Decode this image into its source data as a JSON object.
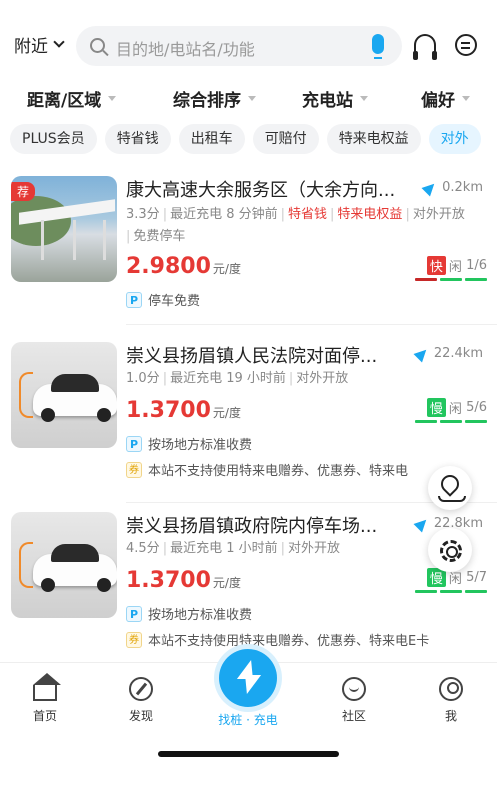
{
  "header": {
    "location": "附近",
    "search_placeholder": "目的地/电站名/功能"
  },
  "filters": [
    "距离/区域",
    "综合排序",
    "充电站",
    "偏好"
  ],
  "chips": [
    {
      "label": "PLUS会员",
      "active": false
    },
    {
      "label": "特省钱",
      "active": false
    },
    {
      "label": "出租车",
      "active": false
    },
    {
      "label": "可赔付",
      "active": false
    },
    {
      "label": "特来电权益",
      "active": false
    },
    {
      "label": "对外",
      "active": true
    }
  ],
  "stations": [
    {
      "recommended_badge": "荐",
      "title": "康大高速大余服务区（大余方向...",
      "distance": "0.2km",
      "score": "3.3分",
      "last_charge": "最近充电 8 分钟前",
      "tags": [
        "特省钱",
        "特来电权益"
      ],
      "access": "对外开放",
      "extra": "免费停车",
      "price": "2.9800",
      "unit": "元/度",
      "speed_tag": "快",
      "free_text": "闲",
      "free_count": "1/6",
      "info_p": "停车免费",
      "info_coupon": ""
    },
    {
      "recommended_badge": "",
      "title": "崇义县扬眉镇人民法院对面停...",
      "distance": "22.4km",
      "score": "1.0分",
      "last_charge": "最近充电 19 小时前",
      "tags": [],
      "access": "对外开放",
      "extra": "",
      "price": "1.3700",
      "unit": "元/度",
      "speed_tag": "慢",
      "free_text": "闲",
      "free_count": "5/6",
      "info_p": "按场地方标准收费",
      "info_coupon": "本站不支持使用特来电赠券、优惠券、特来电"
    },
    {
      "recommended_badge": "",
      "title": "崇义县扬眉镇政府院内停车场...",
      "distance": "22.8km",
      "score": "4.5分",
      "last_charge": "最近充电 1 小时前",
      "tags": [],
      "access": "对外开放",
      "extra": "",
      "price": "1.3700",
      "unit": "元/度",
      "speed_tag": "慢",
      "free_text": "闲",
      "free_count": "5/7",
      "info_p": "按场地方标准收费",
      "info_coupon": "本站不支持使用特来电赠券、优惠券、特来电E卡"
    }
  ],
  "tabbar": {
    "home": "首页",
    "discover": "发现",
    "center": "找桩 · 充电",
    "community": "社区",
    "me": "我"
  },
  "badges": {
    "p": "P",
    "coupon": "券"
  },
  "colors": {
    "accent": "#1aa7f0",
    "price_red": "#e53935",
    "fast_red": "#e53935",
    "slow_green": "#22c55e"
  }
}
